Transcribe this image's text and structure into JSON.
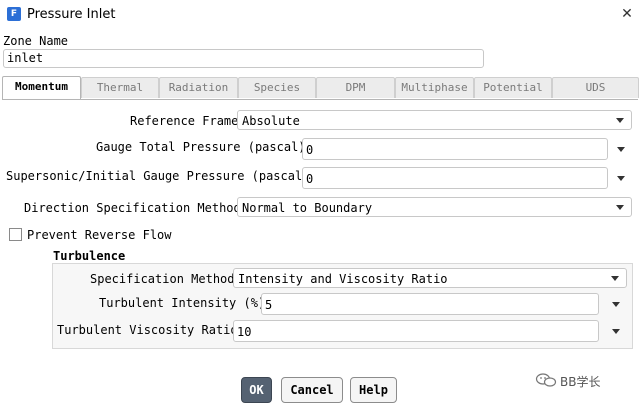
{
  "window": {
    "app_icon_letter": "F",
    "title": "Pressure Inlet",
    "close_glyph": "✕"
  },
  "zone": {
    "label": "Zone Name",
    "value": "inlet"
  },
  "tabs": [
    {
      "label": "Momentum",
      "active": true
    },
    {
      "label": "Thermal",
      "active": false
    },
    {
      "label": "Radiation",
      "active": false
    },
    {
      "label": "Species",
      "active": false
    },
    {
      "label": "DPM",
      "active": false
    },
    {
      "label": "Multiphase",
      "active": false
    },
    {
      "label": "Potential",
      "active": false
    },
    {
      "label": "UDS",
      "active": false
    }
  ],
  "momentum": {
    "reference_frame": {
      "label": "Reference Frame",
      "value": "Absolute"
    },
    "gauge_total_pressure": {
      "label": "Gauge Total Pressure (pascal)",
      "value": "0"
    },
    "supersonic_pressure": {
      "label": "Supersonic/Initial Gauge Pressure (pascal)",
      "value": "0"
    },
    "direction_method": {
      "label": "Direction Specification Method",
      "value": "Normal to Boundary"
    },
    "prevent_reverse_flow": {
      "label": "Prevent Reverse Flow",
      "checked": false
    }
  },
  "turbulence": {
    "title": "Turbulence",
    "spec_method": {
      "label": "Specification Method",
      "value": "Intensity and Viscosity Ratio"
    },
    "intensity": {
      "label": "Turbulent Intensity (%)",
      "value": "5"
    },
    "viscosity_ratio": {
      "label": "Turbulent Viscosity Ratio",
      "value": "10"
    }
  },
  "buttons": {
    "ok": "OK",
    "cancel": "Cancel",
    "help": "Help"
  },
  "watermark": {
    "text": "BB学长",
    "icon": "wechat-icon"
  },
  "colors": {
    "primary_button": "#556272",
    "app_icon": "#2c6fd6"
  }
}
